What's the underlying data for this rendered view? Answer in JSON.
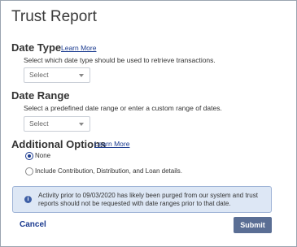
{
  "title": "Trust Report",
  "date_type": {
    "heading": "Date Type",
    "learn_more": "Learn More",
    "description": "Select which date type should be used to retrieve transactions.",
    "select_value": "Select"
  },
  "date_range": {
    "heading": "Date Range",
    "description": "Select a predefined date range or enter a custom range of dates.",
    "select_value": "Select"
  },
  "additional_options": {
    "heading": "Additional Options",
    "learn_more": "Learn More",
    "options": [
      {
        "label": "None",
        "checked": true
      },
      {
        "label": "Include Contribution, Distribution, and Loan details.",
        "checked": false
      }
    ]
  },
  "notice": {
    "icon": "info-icon",
    "icon_glyph": "i",
    "text": "Activity prior to 09/03/2020 has likely been purged from our system and trust reports should not be requested with date ranges prior to that date."
  },
  "actions": {
    "cancel_label": "Cancel",
    "submit_label": "Submit"
  },
  "colors": {
    "link": "#1a3a8f",
    "submit_bg": "#5a6e94",
    "notice_bg": "#dde7f5"
  }
}
